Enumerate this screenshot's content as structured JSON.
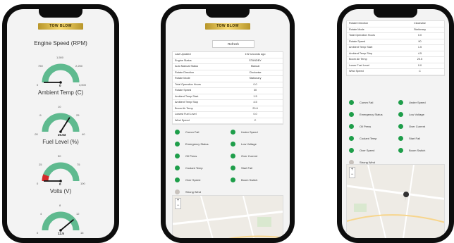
{
  "brand_text": "TOW BLOW",
  "gauges": [
    {
      "title": "Engine Speed (RPM)",
      "min": "0",
      "max": "3,000",
      "t1": "750",
      "t2": "1,500",
      "t3": "2,250",
      "value": "0",
      "needle_fraction": 0.0,
      "red_fraction": 0
    },
    {
      "title": "Ambient Temp (C)",
      "min": "-20",
      "max": "40",
      "t1": "-5",
      "t2": "10",
      "t3": "25",
      "value": "20.63",
      "needle_fraction": 0.68,
      "red_fraction": 0
    },
    {
      "title": "Fuel Level (%)",
      "min": "0",
      "max": "100",
      "t1": "25",
      "t2": "50",
      "t3": "75",
      "value": "0",
      "needle_fraction": 0.0,
      "red_fraction": 0.12
    },
    {
      "title": "Volts (V)",
      "min": "0",
      "max": "16",
      "t1": "4",
      "t2": "8",
      "t3": "12",
      "value": "12.5",
      "needle_fraction": 0.78,
      "red_fraction": 0
    }
  ],
  "refresh_label": "Refresh",
  "info_rows": [
    {
      "label": "Last Updated",
      "value": "192 seconds ago"
    },
    {
      "label": "Engine Status",
      "value": "STANDBY"
    },
    {
      "label": "Auto Manual Status",
      "value": "Manual"
    },
    {
      "label": "Rotate Direction",
      "value": "Clockwise"
    },
    {
      "label": "Rotate Mode",
      "value": "Stationary"
    },
    {
      "label": "Total Operation Hours",
      "value": "0.0"
    },
    {
      "label": "Rotate Speed",
      "value": "30"
    },
    {
      "label": "Ambient Temp Start",
      "value": "1.5"
    },
    {
      "label": "Ambient Temp Stop",
      "value": "4.5"
    },
    {
      "label": "Boom Air Temp",
      "value": "20.6"
    },
    {
      "label": "Lowest Fuel Level",
      "value": "0.0"
    },
    {
      "label": "Wind Speed",
      "value": "C"
    }
  ],
  "info_rows_3": [
    {
      "label": "Rotate Direction",
      "value": "Clockwise"
    },
    {
      "label": "Rotate Mode",
      "value": "Stationary"
    },
    {
      "label": "Total Operation Hours",
      "value": "0.0"
    },
    {
      "label": "Rotate Speed",
      "value": "90"
    },
    {
      "label": "Ambient Temp Start",
      "value": "1.5"
    },
    {
      "label": "Ambient Temp Stop",
      "value": "4.5"
    },
    {
      "label": "Boom Air Temp",
      "value": "20.5"
    },
    {
      "label": "Lower Fuel Level",
      "value": "0.0"
    },
    {
      "label": "Wind Speed",
      "value": "C"
    }
  ],
  "statuses": [
    {
      "label": "Comm Fail",
      "color": "#1e9e4a"
    },
    {
      "label": "Under Speed",
      "color": "#1e9e4a"
    },
    {
      "label": "Emergency Status",
      "color": "#1e9e4a"
    },
    {
      "label": "Low Voltage",
      "color": "#1e9e4a"
    },
    {
      "label": "Oil Press",
      "color": "#1e9e4a"
    },
    {
      "label": "Over Current",
      "color": "#1e9e4a"
    },
    {
      "label": "Coolant Temp",
      "color": "#1e9e4a"
    },
    {
      "label": "Start Fail",
      "color": "#1e9e4a"
    },
    {
      "label": "Over Speed",
      "color": "#1e9e4a"
    },
    {
      "label": "Boom Switch",
      "color": "#1e9e4a"
    },
    {
      "label": "Strong Wind",
      "color": "#c8c2bd"
    }
  ],
  "map_zoom_in": "+",
  "map_zoom_out": "−",
  "colors": {
    "gauge_green": "#5fba8f",
    "gauge_red": "#d42a2a",
    "status_ok": "#1e9e4a"
  }
}
